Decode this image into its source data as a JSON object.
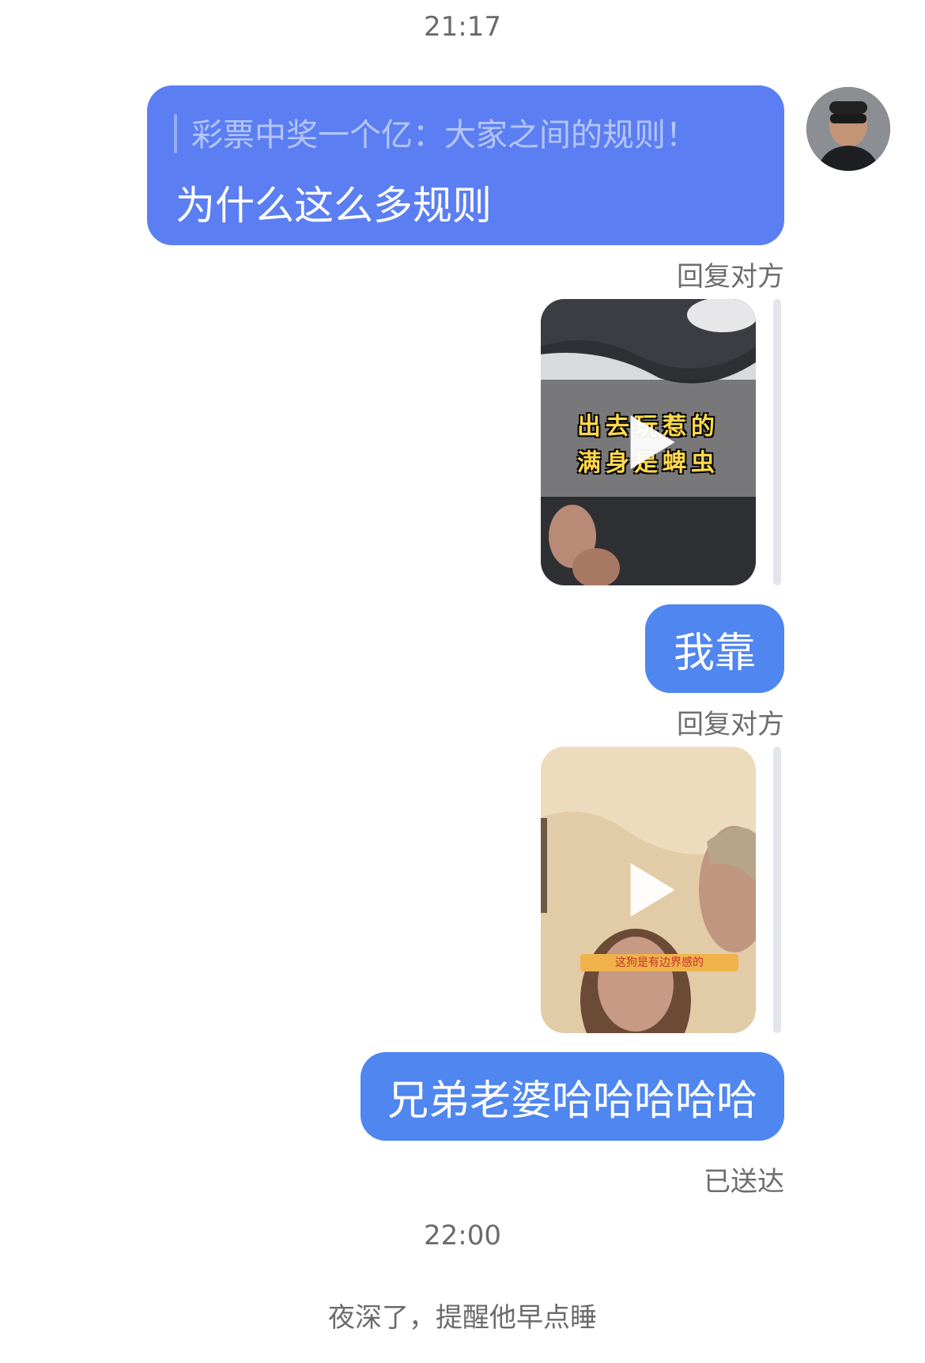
{
  "timestamps": {
    "first": "21:17",
    "second": "22:00"
  },
  "quoted_message": {
    "quote": "彩票中奖一个亿：大家之间的规则！",
    "text": "为什么这么多规则"
  },
  "reply_label_1": "回复对方",
  "video_1": {
    "caption_line1": "出去玩惹的",
    "caption_line2": "满身是蜱虫",
    "icon": "play-icon"
  },
  "message_2": "我靠",
  "reply_label_2": "回复对方",
  "video_2": {
    "subtitle": "这狗是有边界感的",
    "icon": "play-icon"
  },
  "message_3": "兄弟老婆哈哈哈哈哈",
  "delivery_status": "已送达",
  "system_tip": "夜深了，提醒他早点睡",
  "colors": {
    "bubble_quoted": "#5b7ff2",
    "bubble": "#4f86f0"
  }
}
